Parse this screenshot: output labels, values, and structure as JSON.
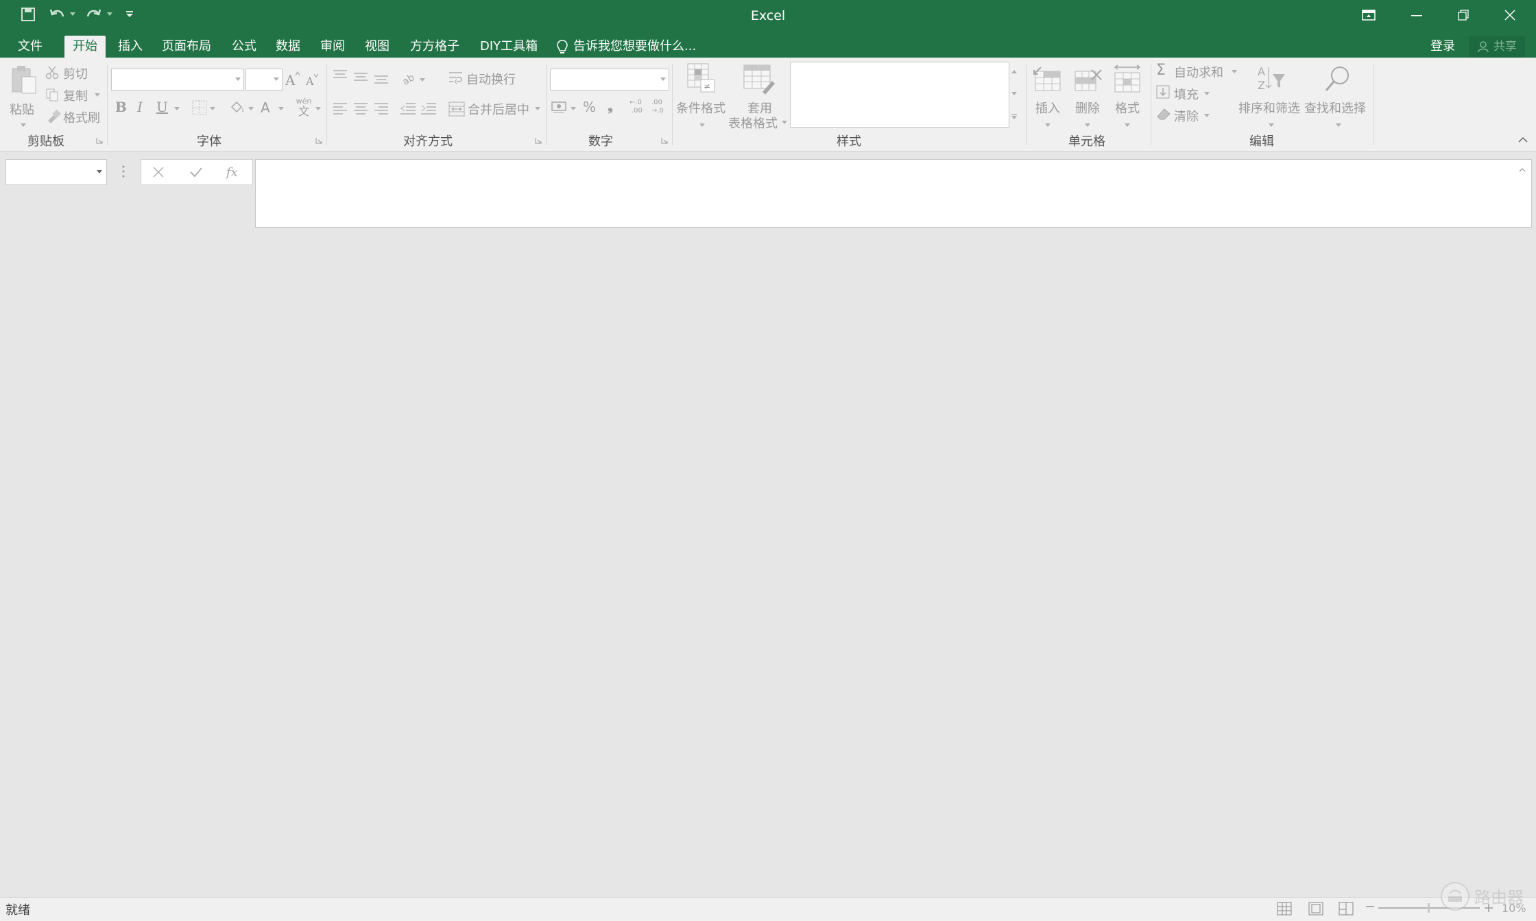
{
  "app": {
    "title": "Excel"
  },
  "tabs": {
    "file": "文件",
    "home": "开始",
    "insert": "插入",
    "page_layout": "页面布局",
    "formulas": "公式",
    "data": "数据",
    "review": "审阅",
    "view": "视图",
    "ffgz": "方方格子",
    "diy": "DIY工具箱"
  },
  "tell_me": "告诉我您想要做什么...",
  "account": {
    "login": "登录",
    "share": "共享"
  },
  "clipboard": {
    "paste": "粘贴",
    "cut": "剪切",
    "copy": "复制",
    "format_painter": "格式刷",
    "group": "剪贴板"
  },
  "font": {
    "group": "字体",
    "bold": "B",
    "italic": "I",
    "underline": "U",
    "phonetic_top": "wén",
    "phonetic_bottom": "文"
  },
  "alignment": {
    "wrap_text": "自动换行",
    "merge_center": "合并后居中",
    "group": "对齐方式"
  },
  "number": {
    "percent": "%",
    "comma": "❟",
    "group": "数字"
  },
  "styles": {
    "conditional": "条件格式",
    "table_format_line1": "套用",
    "table_format_line2": "表格格式",
    "group": "样式"
  },
  "cells": {
    "insert": "插入",
    "delete": "删除",
    "format": "格式",
    "group": "单元格"
  },
  "editing": {
    "autosum": "自动求和",
    "fill": "填充",
    "clear": "清除",
    "sort_filter": "排序和筛选",
    "find_select": "查找和选择",
    "group": "编辑"
  },
  "status": {
    "text": "就绪",
    "zoom": "10%",
    "watermark": "路由器"
  },
  "colors": {
    "brand": "#217346",
    "ribbon_bg": "#f0f0f0",
    "workspace": "#e6e6e6"
  }
}
